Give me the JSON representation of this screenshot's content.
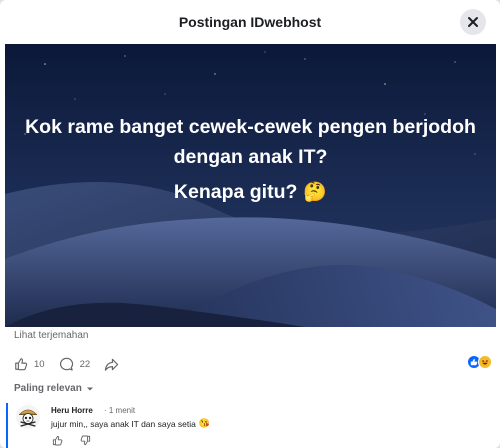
{
  "header": {
    "title": "Postingan IDwebhost"
  },
  "post": {
    "headline": "Kok rame banget cewek-cewek pengen berjodoh dengan anak IT?",
    "subline": "Kenapa gitu?",
    "subline_emoji": "🤔",
    "translate_link": "Lihat terjemahan"
  },
  "actions": {
    "like_count": "10",
    "comment_count": "22"
  },
  "reactions": {
    "colors": {
      "like": "#0866ff",
      "haha": "#f7b928"
    }
  },
  "comments_filter": {
    "label": "Paling relevan"
  },
  "comment": {
    "author": "Heru Horre",
    "time": "· 1 menit",
    "text": "jujur min,, saya anak IT dan saya setia",
    "emoji": "😘"
  },
  "colors": {
    "accent": "#0866ff",
    "text_secondary": "#65676b",
    "close_bg": "#e4e6eb"
  }
}
